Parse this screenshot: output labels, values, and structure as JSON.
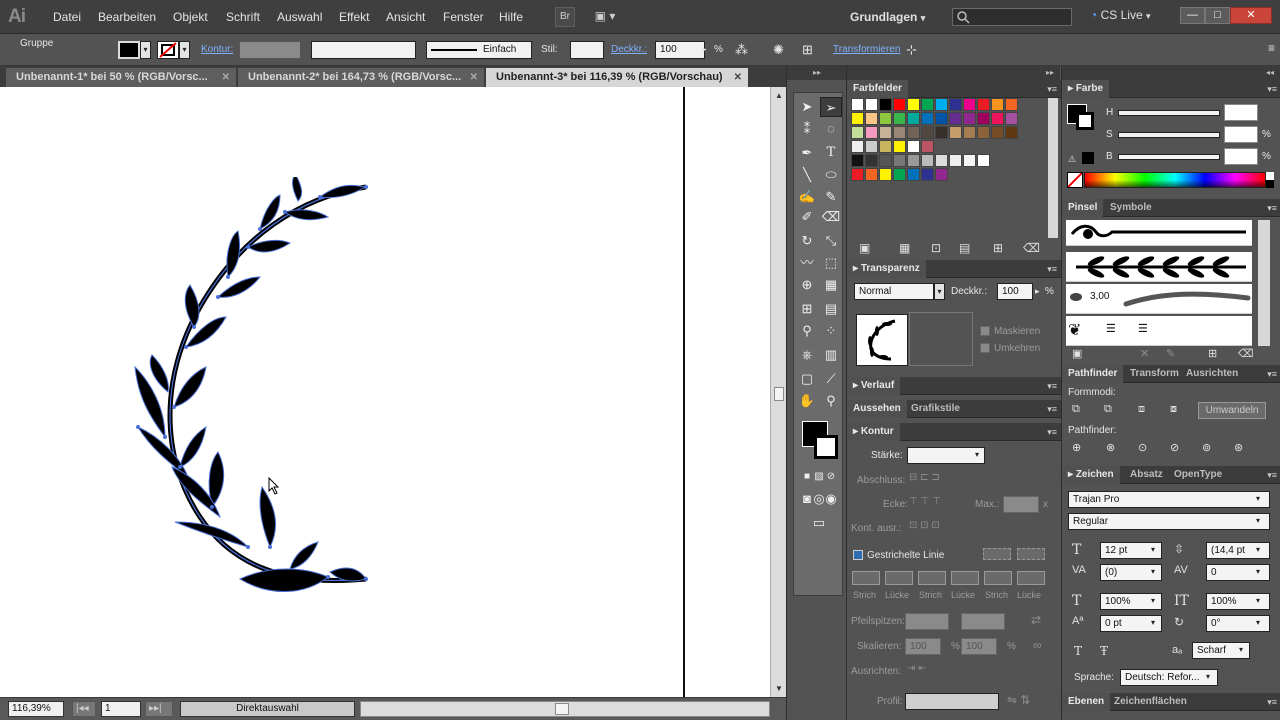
{
  "app": {
    "logo": "Ai"
  },
  "menu": [
    "Datei",
    "Bearbeiten",
    "Objekt",
    "Schrift",
    "Auswahl",
    "Effekt",
    "Ansicht",
    "Fenster",
    "Hilfe"
  ],
  "menu_buttons": {
    "bridge": "Br",
    "arrange": "▣ ▾"
  },
  "workspace": {
    "label": "Grundlagen",
    "cslive": "CS Live"
  },
  "window_controls": {
    "minimize": "—",
    "maximize": "□",
    "close": "✕"
  },
  "control_bar": {
    "selection": "Gruppe",
    "stroke_link": "Kontur:",
    "stroke_style": "Einfach",
    "style_label": "Stil:",
    "opacity_link": "Deckkr.:",
    "opacity_value": "100",
    "opacity_unit": "%",
    "transform_link": "Transformieren"
  },
  "tabs": [
    {
      "label": "Unbenannt-1* bei 50 % (RGB/Vorsc...",
      "close": "✕"
    },
    {
      "label": "Unbenannt-2* bei 164,73 % (RGB/Vorsc...",
      "close": "✕"
    },
    {
      "label": "Unbenannt-3* bei 116,39 % (RGB/Vorschau)",
      "close": "✕"
    }
  ],
  "status": {
    "zoom": "116,39%",
    "page": "1",
    "tool": "Direktauswahl"
  },
  "farbfelder": {
    "title": "Farbfelder",
    "rows": [
      [
        "#ffffff",
        "#ffffff",
        "#000000",
        "#ff0000",
        "#ffff00",
        "#00a651",
        "#00aeef",
        "#2e3192",
        "#ec008c",
        "#ed1c24",
        "#f7941d",
        "#f26522"
      ],
      [
        "#fff200",
        "#fdc689",
        "#8dc63f",
        "#39b54a",
        "#00a99d",
        "#0072bc",
        "#0054a6",
        "#662d91",
        "#92278f",
        "#9e005d",
        "#ed145b",
        "#a4509e"
      ],
      [
        "#c4df9b",
        "#f49ac1",
        "#c7b299",
        "#998675",
        "#736357",
        "#534741",
        "#37302d",
        "#c69c6d",
        "#a67c52",
        "#8c6239",
        "#754c24",
        "#603913"
      ],
      [
        "#eeeeee",
        "#cccccc",
        "#c8b560",
        "#fff200",
        "#ffffff",
        "#bb5566"
      ],
      [
        "#111111",
        "#333333",
        "#555555",
        "#777777",
        "#999999",
        "#bbbbbb",
        "#dddddd",
        "#eeeeee",
        "#f5f5f5",
        "#ffffff"
      ],
      [
        "#ed1c24",
        "#f26522",
        "#fff200",
        "#00a651",
        "#0072bc",
        "#2e3192",
        "#92278f"
      ]
    ]
  },
  "transparenz": {
    "title": "Transparenz",
    "mode": "Normal",
    "opacity_label": "Deckkr.:",
    "opacity_value": "100",
    "opacity_unit": "%",
    "mask_label": "Maskieren",
    "invert_label": "Umkehren"
  },
  "verlauf": {
    "title": "Verlauf"
  },
  "aussehen": {
    "tab1": "Aussehen",
    "tab2": "Grafikstile"
  },
  "kontur": {
    "title": "Kontur",
    "staerke_label": "Stärke:",
    "abschluss_label": "Abschluss:",
    "ecke_label": "Ecke:",
    "max_label": "Max.:",
    "max_unit": "x",
    "kontur_ausr_label": "Kont. ausr.:",
    "dashed_label": "Gestrichelte Linie",
    "dash_labels": [
      "Strich",
      "Lücke",
      "Strich",
      "Lücke",
      "Strich",
      "Lücke"
    ],
    "pfeilspitzen_label": "Pfeilspitzen:",
    "skalieren_label": "Skalieren:",
    "skalieren_value1": "100",
    "skalieren_value2": "100",
    "skalieren_unit": "%",
    "ausrichten_label": "Ausrichten:",
    "profil_label": "Profil:"
  },
  "farbe": {
    "title": "Farbe",
    "h_label": "H",
    "s_label": "S",
    "b_label": "B",
    "unit": "%"
  },
  "pinsel": {
    "tab1": "Pinsel",
    "tab2": "Symbole",
    "stroke_value": "3,00"
  },
  "pathfinder": {
    "tab1": "Pathfinder",
    "tab2": "Transform",
    "tab3": "Ausrichten",
    "formmodi_label": "Formmodi:",
    "umwandeln_label": "Umwandeln",
    "pathfinder_label": "Pathfinder:"
  },
  "zeichen": {
    "tab1": "Zeichen",
    "tab2": "Absatz",
    "tab3": "OpenType",
    "font_family": "Trajan Pro",
    "font_style": "Regular",
    "font_size": "12 pt",
    "leading": "(14,4 pt",
    "kerning": "(0)",
    "tracking": "0",
    "vscale": "100%",
    "hscale": "100%",
    "baseline": "0 pt",
    "rotation": "0°",
    "aa": "Scharf",
    "language_label": "Sprache:",
    "language_value": "Deutsch: Refor..."
  },
  "ebenen": {
    "tab1": "Ebenen",
    "tab2": "Zeichenflächen"
  },
  "colors": {
    "accent_link": "#7fb1ff",
    "selection_blue": "#4a6fd6"
  }
}
